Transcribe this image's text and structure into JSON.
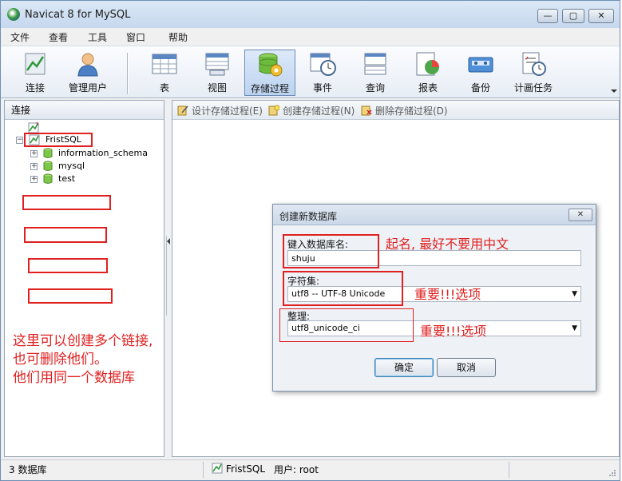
{
  "window": {
    "title": "Navicat 8 for MySQL",
    "minimize_glyph": "—",
    "maximize_glyph": "▢",
    "close_glyph": "✕"
  },
  "menu": [
    "文件",
    "查看",
    "工具",
    "窗口",
    "帮助"
  ],
  "toolbar": {
    "items": [
      {
        "label": "连接",
        "icon": "connect-icon"
      },
      {
        "label": "管理用户",
        "icon": "user-icon"
      },
      {
        "label": "表",
        "icon": "table-icon"
      },
      {
        "label": "视图",
        "icon": "view-icon"
      },
      {
        "label": "存储过程",
        "icon": "procedure-icon",
        "active": true
      },
      {
        "label": "事件",
        "icon": "event-icon"
      },
      {
        "label": "查询",
        "icon": "query-icon"
      },
      {
        "label": "报表",
        "icon": "report-icon"
      },
      {
        "label": "备份",
        "icon": "backup-icon"
      },
      {
        "label": "计画任务",
        "icon": "schedule-icon"
      }
    ]
  },
  "left_panel": {
    "header": "连接",
    "connection": "FristSQL",
    "databases": [
      "information_schema",
      "mysql",
      "test"
    ],
    "annotation": [
      "这里可以创建多个链接,",
      "也可删除他们。",
      "他们用同一个数据库"
    ]
  },
  "proc_toolbar": {
    "design": "设计存储过程(E)",
    "create": "创建存储过程(N)",
    "delete": "删除存储过程(D)"
  },
  "dialog": {
    "title": "创建新数据库",
    "close_glyph": "✕",
    "db_name_label": "键入数据库名:",
    "db_name_value": "shuju",
    "charset_label": "字符集:",
    "charset_value": "utf8 -- UTF-8 Unicode",
    "collation_label": "整理:",
    "collation_value": "utf8_unicode_ci",
    "ok": "确定",
    "cancel": "取消",
    "annotations": {
      "name": "起名, 最好不要用中文",
      "charset": "重要!!!选项",
      "collation": "重要!!!选项"
    }
  },
  "status": {
    "db_count": "3 数据库",
    "connection": "FristSQL",
    "user": "用户: root"
  },
  "colors": {
    "annotation": "#e02020",
    "accent": "#3c7fb1"
  }
}
